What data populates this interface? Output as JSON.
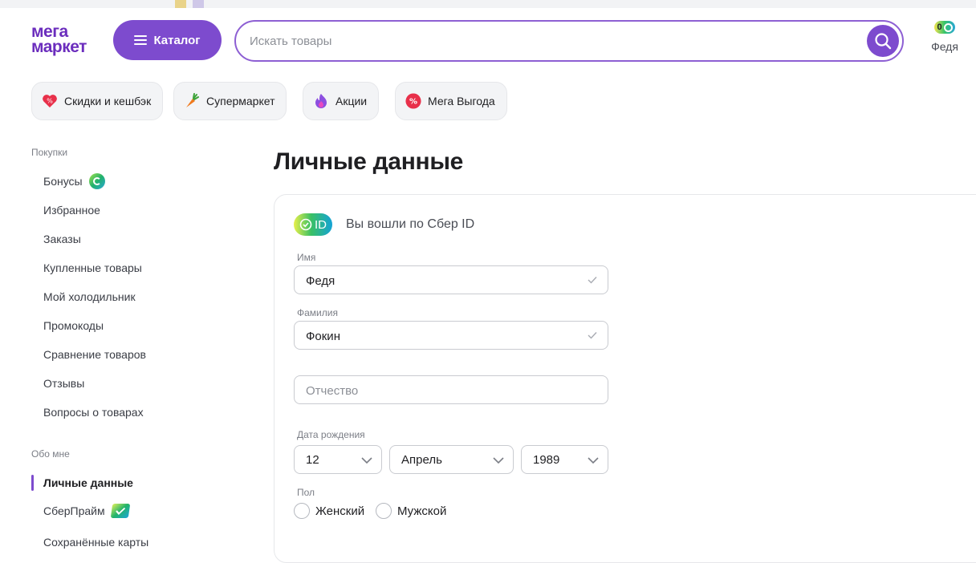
{
  "header": {
    "logo_line1": "мега",
    "logo_line2": "маркет",
    "catalog_label": "Каталог",
    "search_placeholder": "Искать товары",
    "bonus_value": "0",
    "user_name": "Федя"
  },
  "chips": [
    {
      "label": "Скидки и кешбэк",
      "icon": "heart-percent-icon"
    },
    {
      "label": "Супермаркет",
      "icon": "carrot-icon"
    },
    {
      "label": "Акции",
      "icon": "flame-icon"
    },
    {
      "label": "Мега Выгода",
      "icon": "percent-circle-icon"
    }
  ],
  "sidebar": {
    "section_purchases": "Покупки",
    "items_purchases": [
      {
        "label": "Бонусы",
        "icon": "bonus-icon"
      },
      {
        "label": "Избранное"
      },
      {
        "label": "Заказы"
      },
      {
        "label": "Купленные товары"
      },
      {
        "label": "Мой холодильник"
      },
      {
        "label": "Промокоды"
      },
      {
        "label": "Сравнение товаров"
      },
      {
        "label": "Отзывы"
      },
      {
        "label": "Вопросы о товарах"
      }
    ],
    "section_about": "Обо мне",
    "items_about": [
      {
        "label": "Личные данные",
        "active": true
      },
      {
        "label": "СберПрайм",
        "icon": "sberprime-icon"
      },
      {
        "label": "Сохранённые карты"
      }
    ]
  },
  "main": {
    "title": "Личные данные",
    "sber_badge": "ID",
    "sber_text": "Вы вошли по Сбер ID",
    "first_name_label": "Имя",
    "first_name_value": "Федя",
    "last_name_label": "Фамилия",
    "last_name_value": "Фокин",
    "patronymic_placeholder": "Отчество",
    "birth_label": "Дата рождения",
    "birth_day": "12",
    "birth_month": "Апрель",
    "birth_year": "1989",
    "gender_label": "Пол",
    "gender_female": "Женский",
    "gender_male": "Мужской"
  },
  "colors": {
    "brand": "#7d4bce",
    "accent_text": "#6b2dbd"
  }
}
